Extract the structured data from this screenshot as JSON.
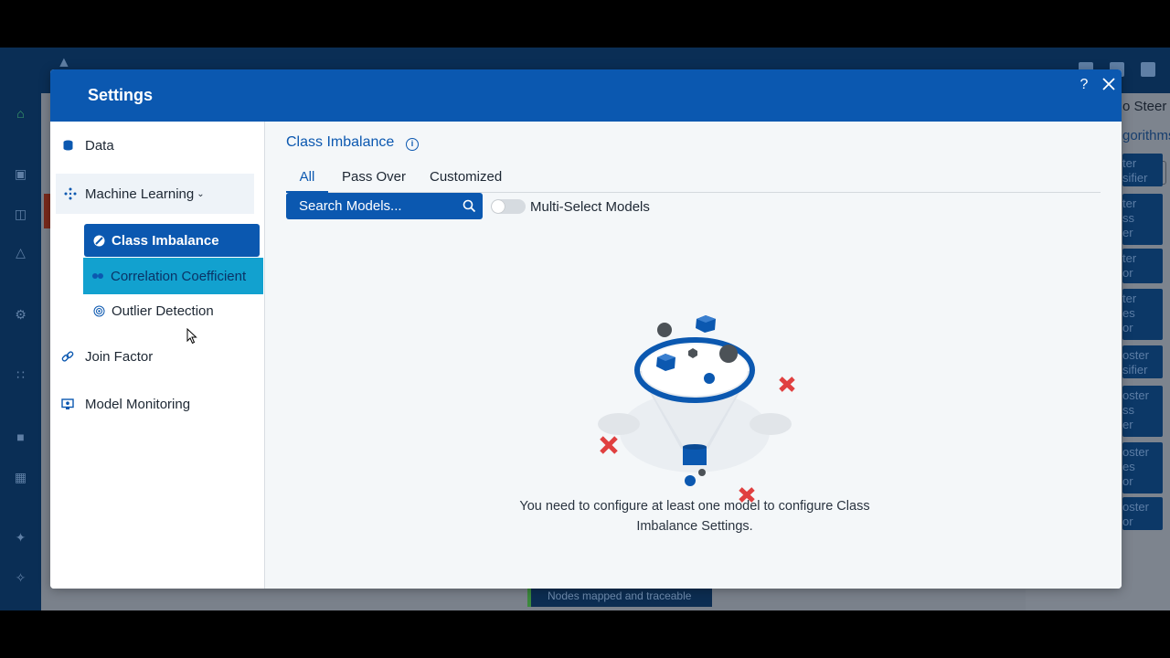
{
  "background_app": {
    "steer_label": "o Steer",
    "algorithms_label": "gorithms",
    "card_labels": [
      "ter\nsifier",
      "ter\nss\ner",
      "ter\nor",
      "ter\nes\nor",
      "oster\nsifier",
      "oster\nss\ner",
      "oster\nes\nor",
      "oster\nor"
    ],
    "toast": "Nodes mapped and traceable"
  },
  "modal": {
    "title": "Settings",
    "help_label": "?",
    "close_label": "✕"
  },
  "sidebar": {
    "data_label": "Data",
    "ml_label": "Machine Learning",
    "ml_caret": "⌄",
    "sub_items": [
      "Class Imbalance",
      "Correlation Coefficient",
      "Outlier Detection"
    ],
    "join_factor_label": "Join Factor",
    "model_monitoring_label": "Model Monitoring"
  },
  "main": {
    "section_title": "Class Imbalance",
    "info_icon": "i",
    "tabs": [
      "All",
      "Pass Over",
      "Customized"
    ],
    "search_placeholder": "Search Models...",
    "toggle_label": "Multi-Select Models",
    "empty_message": "You need to configure at least one model to configure Class Imbalance Settings."
  },
  "colors": {
    "primary": "#0b58b0",
    "hover": "#12a1cf",
    "reject": "#e04040"
  },
  "icons": {
    "data": "database-icon",
    "ml": "network-icon",
    "class_imbalance": "balance-icon",
    "correlation": "correlation-icon",
    "outlier": "target-icon",
    "join": "link-icon",
    "monitoring": "monitor-icon"
  }
}
